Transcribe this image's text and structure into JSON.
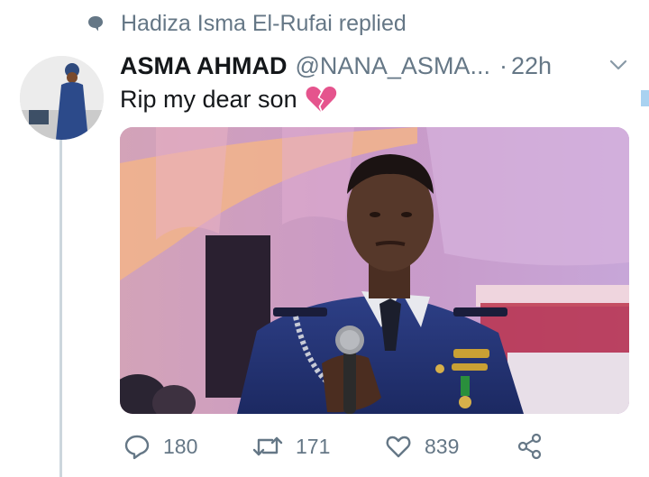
{
  "context": {
    "replied_text": "Hadiza Isma El-Rufai replied",
    "icon": "speech-bubble-icon"
  },
  "tweet": {
    "display_name": "ASMA AHMAD",
    "handle": "@NANA_ASMA...",
    "dot": "·",
    "time": "22h",
    "text": "Rip my dear son",
    "emoji": "broken-heart-icon"
  },
  "actions": {
    "reply_count": "180",
    "retweet_count": "171",
    "like_count": "839"
  },
  "colors": {
    "secondary_text": "#657786",
    "primary_text": "#14171a",
    "thread_line": "#ccd6dd",
    "emoji_heart": "#e5548d"
  }
}
